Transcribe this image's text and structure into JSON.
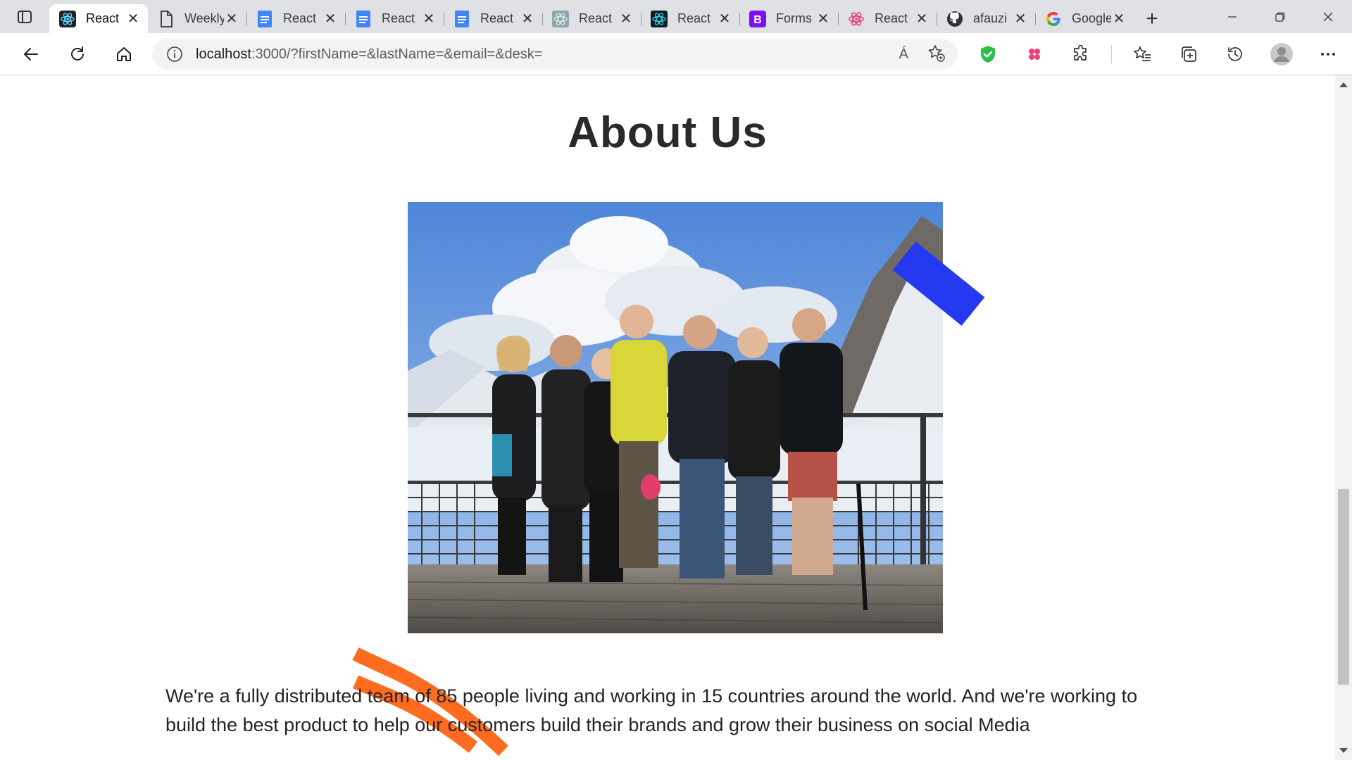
{
  "browser": {
    "tabs": [
      {
        "title": "React",
        "icon": "react-icon",
        "active": true
      },
      {
        "title": "Weekly",
        "icon": "document-icon"
      },
      {
        "title": "React",
        "icon": "google-docs-icon"
      },
      {
        "title": "React",
        "icon": "google-docs-icon"
      },
      {
        "title": "React",
        "icon": "google-docs-icon"
      },
      {
        "title": "React",
        "icon": "react-bootstrap-icon"
      },
      {
        "title": "React",
        "icon": "react-bootstrap-icon"
      },
      {
        "title": "Forms",
        "icon": "bootstrap-icon"
      },
      {
        "title": "React",
        "icon": "react-pink-icon"
      },
      {
        "title": "afauzi",
        "icon": "github-icon"
      },
      {
        "title": "Google",
        "icon": "google-icon"
      }
    ],
    "address": {
      "host": "localhost",
      "path": ":3000/?firstName=&lastName=&email=&desk="
    },
    "read_aloud_label": "Á"
  },
  "page": {
    "title": "About Us",
    "description": "We're a fully distributed team of 85 people living and working in 15 countries around the world. And we're working to build the best product to help our customers build their brands and grow their business on social Media"
  },
  "colors": {
    "tape": "#2439f0",
    "strokes": "#ff6b1f",
    "shield": "#2fbf4b"
  }
}
